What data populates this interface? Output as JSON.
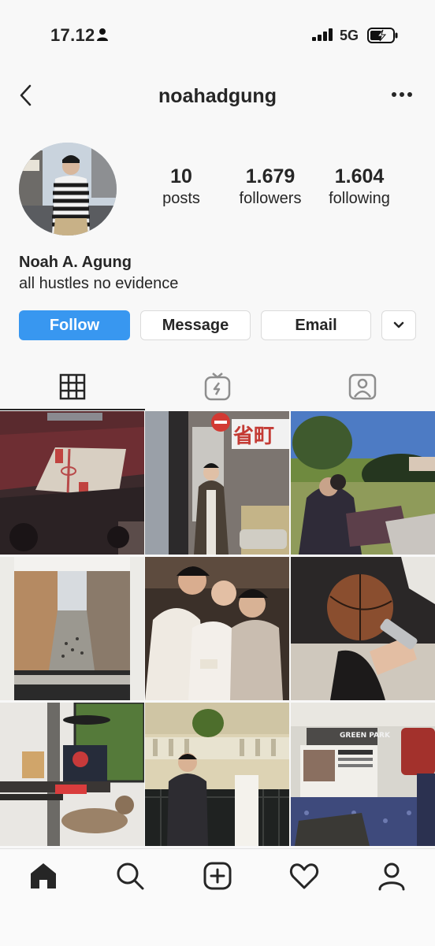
{
  "status_bar": {
    "time": "17.12",
    "network": "5G"
  },
  "header": {
    "username": "noahadgung"
  },
  "profile": {
    "stats": [
      {
        "value": "10",
        "label": "posts"
      },
      {
        "value": "1.679",
        "label": "followers"
      },
      {
        "value": "1.604",
        "label": "following"
      }
    ],
    "full_name": "Noah A. Agung",
    "bio": "all hustles no evidence"
  },
  "actions": {
    "follow": "Follow",
    "message": "Message",
    "email": "Email"
  },
  "tabs": [
    "grid-icon",
    "igtv-icon",
    "tagged-icon"
  ],
  "posts": [
    {
      "scene": "basketball arena",
      "sign_text": ""
    },
    {
      "scene": "tokyo street",
      "sign_text": "省町"
    },
    {
      "scene": "park picnic",
      "sign_text": ""
    },
    {
      "scene": "window street view",
      "sign_text": ""
    },
    {
      "scene": "friends at night",
      "sign_text": ""
    },
    {
      "scene": "basketball in hand",
      "sign_text": ""
    },
    {
      "scene": "desk with cat",
      "sign_text": ""
    },
    {
      "scene": "balcony",
      "sign_text": ""
    },
    {
      "scene": "train newspaper",
      "sign_text": "GREEN PARK"
    }
  ],
  "colors": {
    "follow_blue": "#3897f0",
    "text": "#262626",
    "border": "#dbdbdb"
  },
  "bottom_nav": [
    "home-icon",
    "search-icon",
    "new-post-icon",
    "activity-heart-icon",
    "profile-icon"
  ]
}
